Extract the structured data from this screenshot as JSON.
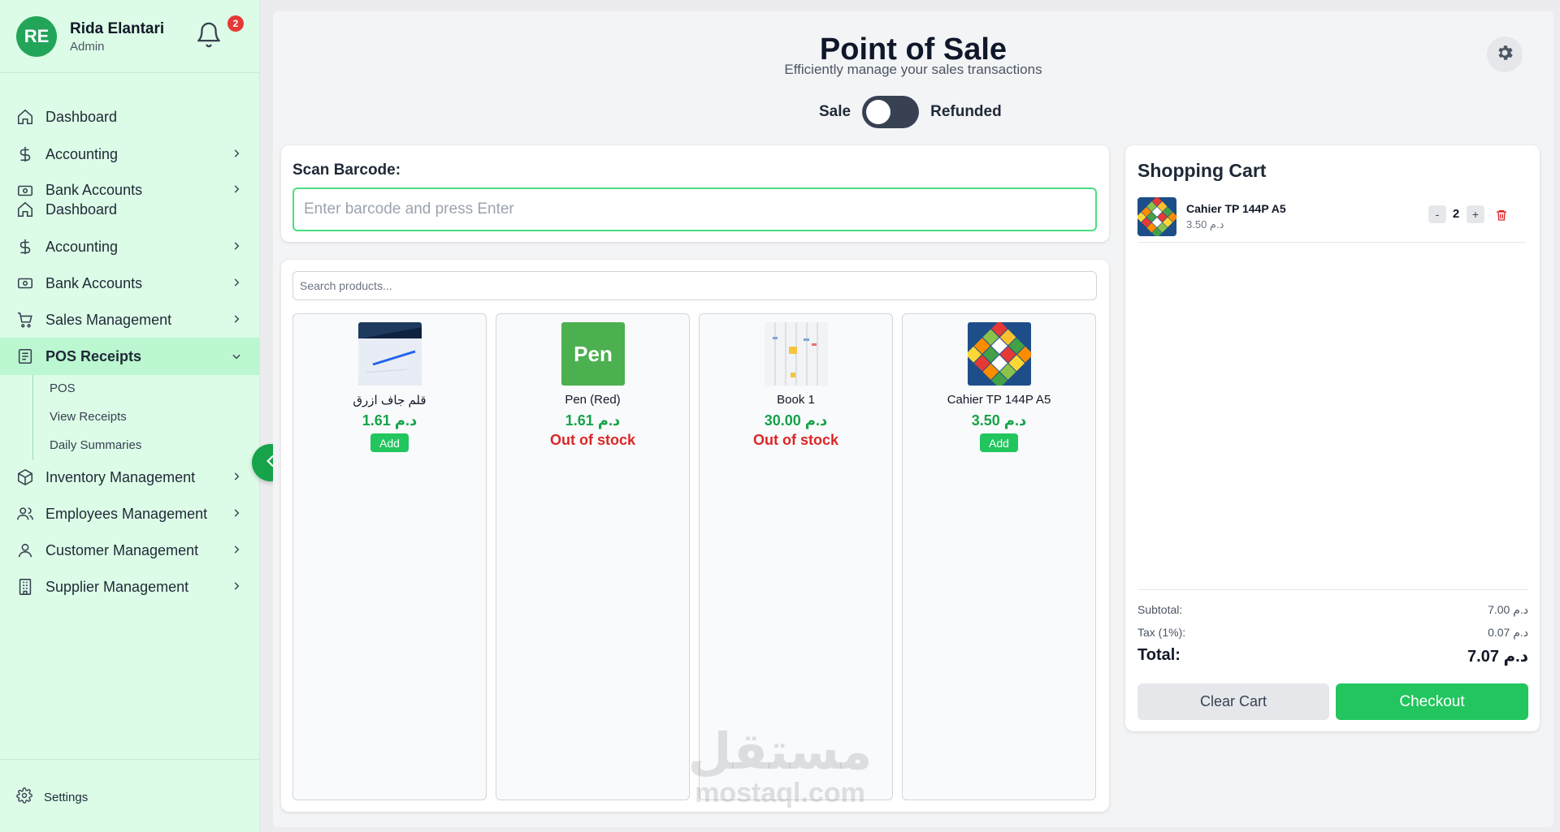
{
  "user": {
    "initials": "RE",
    "name": "Rida Elantari",
    "role": "Admin",
    "notifications": "2"
  },
  "nav": [
    {
      "label": "Dashboard",
      "icon": "home-icon",
      "chevron": false
    },
    {
      "label": "Accounting",
      "icon": "dollar-icon",
      "chevron": true
    },
    {
      "label": "Bank Accounts",
      "icon": "bank-icon",
      "chevron": true
    },
    {
      "label": "Dashboard",
      "icon": "home-icon",
      "chevron": false
    },
    {
      "label": "Accounting",
      "icon": "dollar-icon",
      "chevron": true
    },
    {
      "label": "Bank Accounts",
      "icon": "bank-icon",
      "chevron": true
    },
    {
      "label": "Sales Management",
      "icon": "cart-icon",
      "chevron": true
    },
    {
      "label": "POS Receipts",
      "icon": "receipt-icon",
      "chevron": true,
      "active": true
    },
    {
      "label": "Inventory Management",
      "icon": "box-icon",
      "chevron": true
    },
    {
      "label": "Employees Management",
      "icon": "users-icon",
      "chevron": true
    },
    {
      "label": "Customer Management",
      "icon": "user-icon",
      "chevron": true
    },
    {
      "label": "Supplier Management",
      "icon": "building-icon",
      "chevron": true
    }
  ],
  "subnav": [
    "POS",
    "View Receipts",
    "Daily Summaries"
  ],
  "settings_label": "Settings",
  "header": {
    "title": "Point of Sale",
    "subtitle": "Efficiently manage your sales transactions"
  },
  "mode": {
    "left": "Sale",
    "right": "Refunded",
    "refund_on": false
  },
  "scan": {
    "label": "Scan Barcode:",
    "placeholder": "Enter barcode and press Enter"
  },
  "search": {
    "placeholder": "Search products..."
  },
  "products": [
    {
      "name": "قلم جاف ازرق",
      "price": "1.61 د.م",
      "status": "Add",
      "in_stock": true
    },
    {
      "name": "Pen (Red)",
      "price": "1.61 د.م",
      "status": "Out of stock",
      "in_stock": false,
      "img_text": "Pen"
    },
    {
      "name": "Book 1",
      "price": "30.00 د.م",
      "status": "Out of stock",
      "in_stock": false
    },
    {
      "name": "Cahier TP 144P A5",
      "price": "3.50 د.م",
      "status": "Add",
      "in_stock": true
    }
  ],
  "cart": {
    "title": "Shopping Cart",
    "items": [
      {
        "name": "Cahier TP 144P A5",
        "price": "3.50 د.م",
        "qty": "2",
        "minus": "-",
        "plus": "+"
      }
    ],
    "subtotal_label": "Subtotal:",
    "subtotal": "7.00 د.م",
    "tax_label": "Tax (1%):",
    "tax": "0.07 د.م",
    "total_label": "Total:",
    "total": "7.07 د.م",
    "clear_label": "Clear Cart",
    "checkout_label": "Checkout"
  },
  "watermark": {
    "arabic": "مستقل",
    "latin": "mostaql.com"
  },
  "colors": {
    "sidebar": "#dcfce7",
    "accent": "#22c55e",
    "danger": "#dc2626",
    "active_item": "#bbf7d0"
  }
}
